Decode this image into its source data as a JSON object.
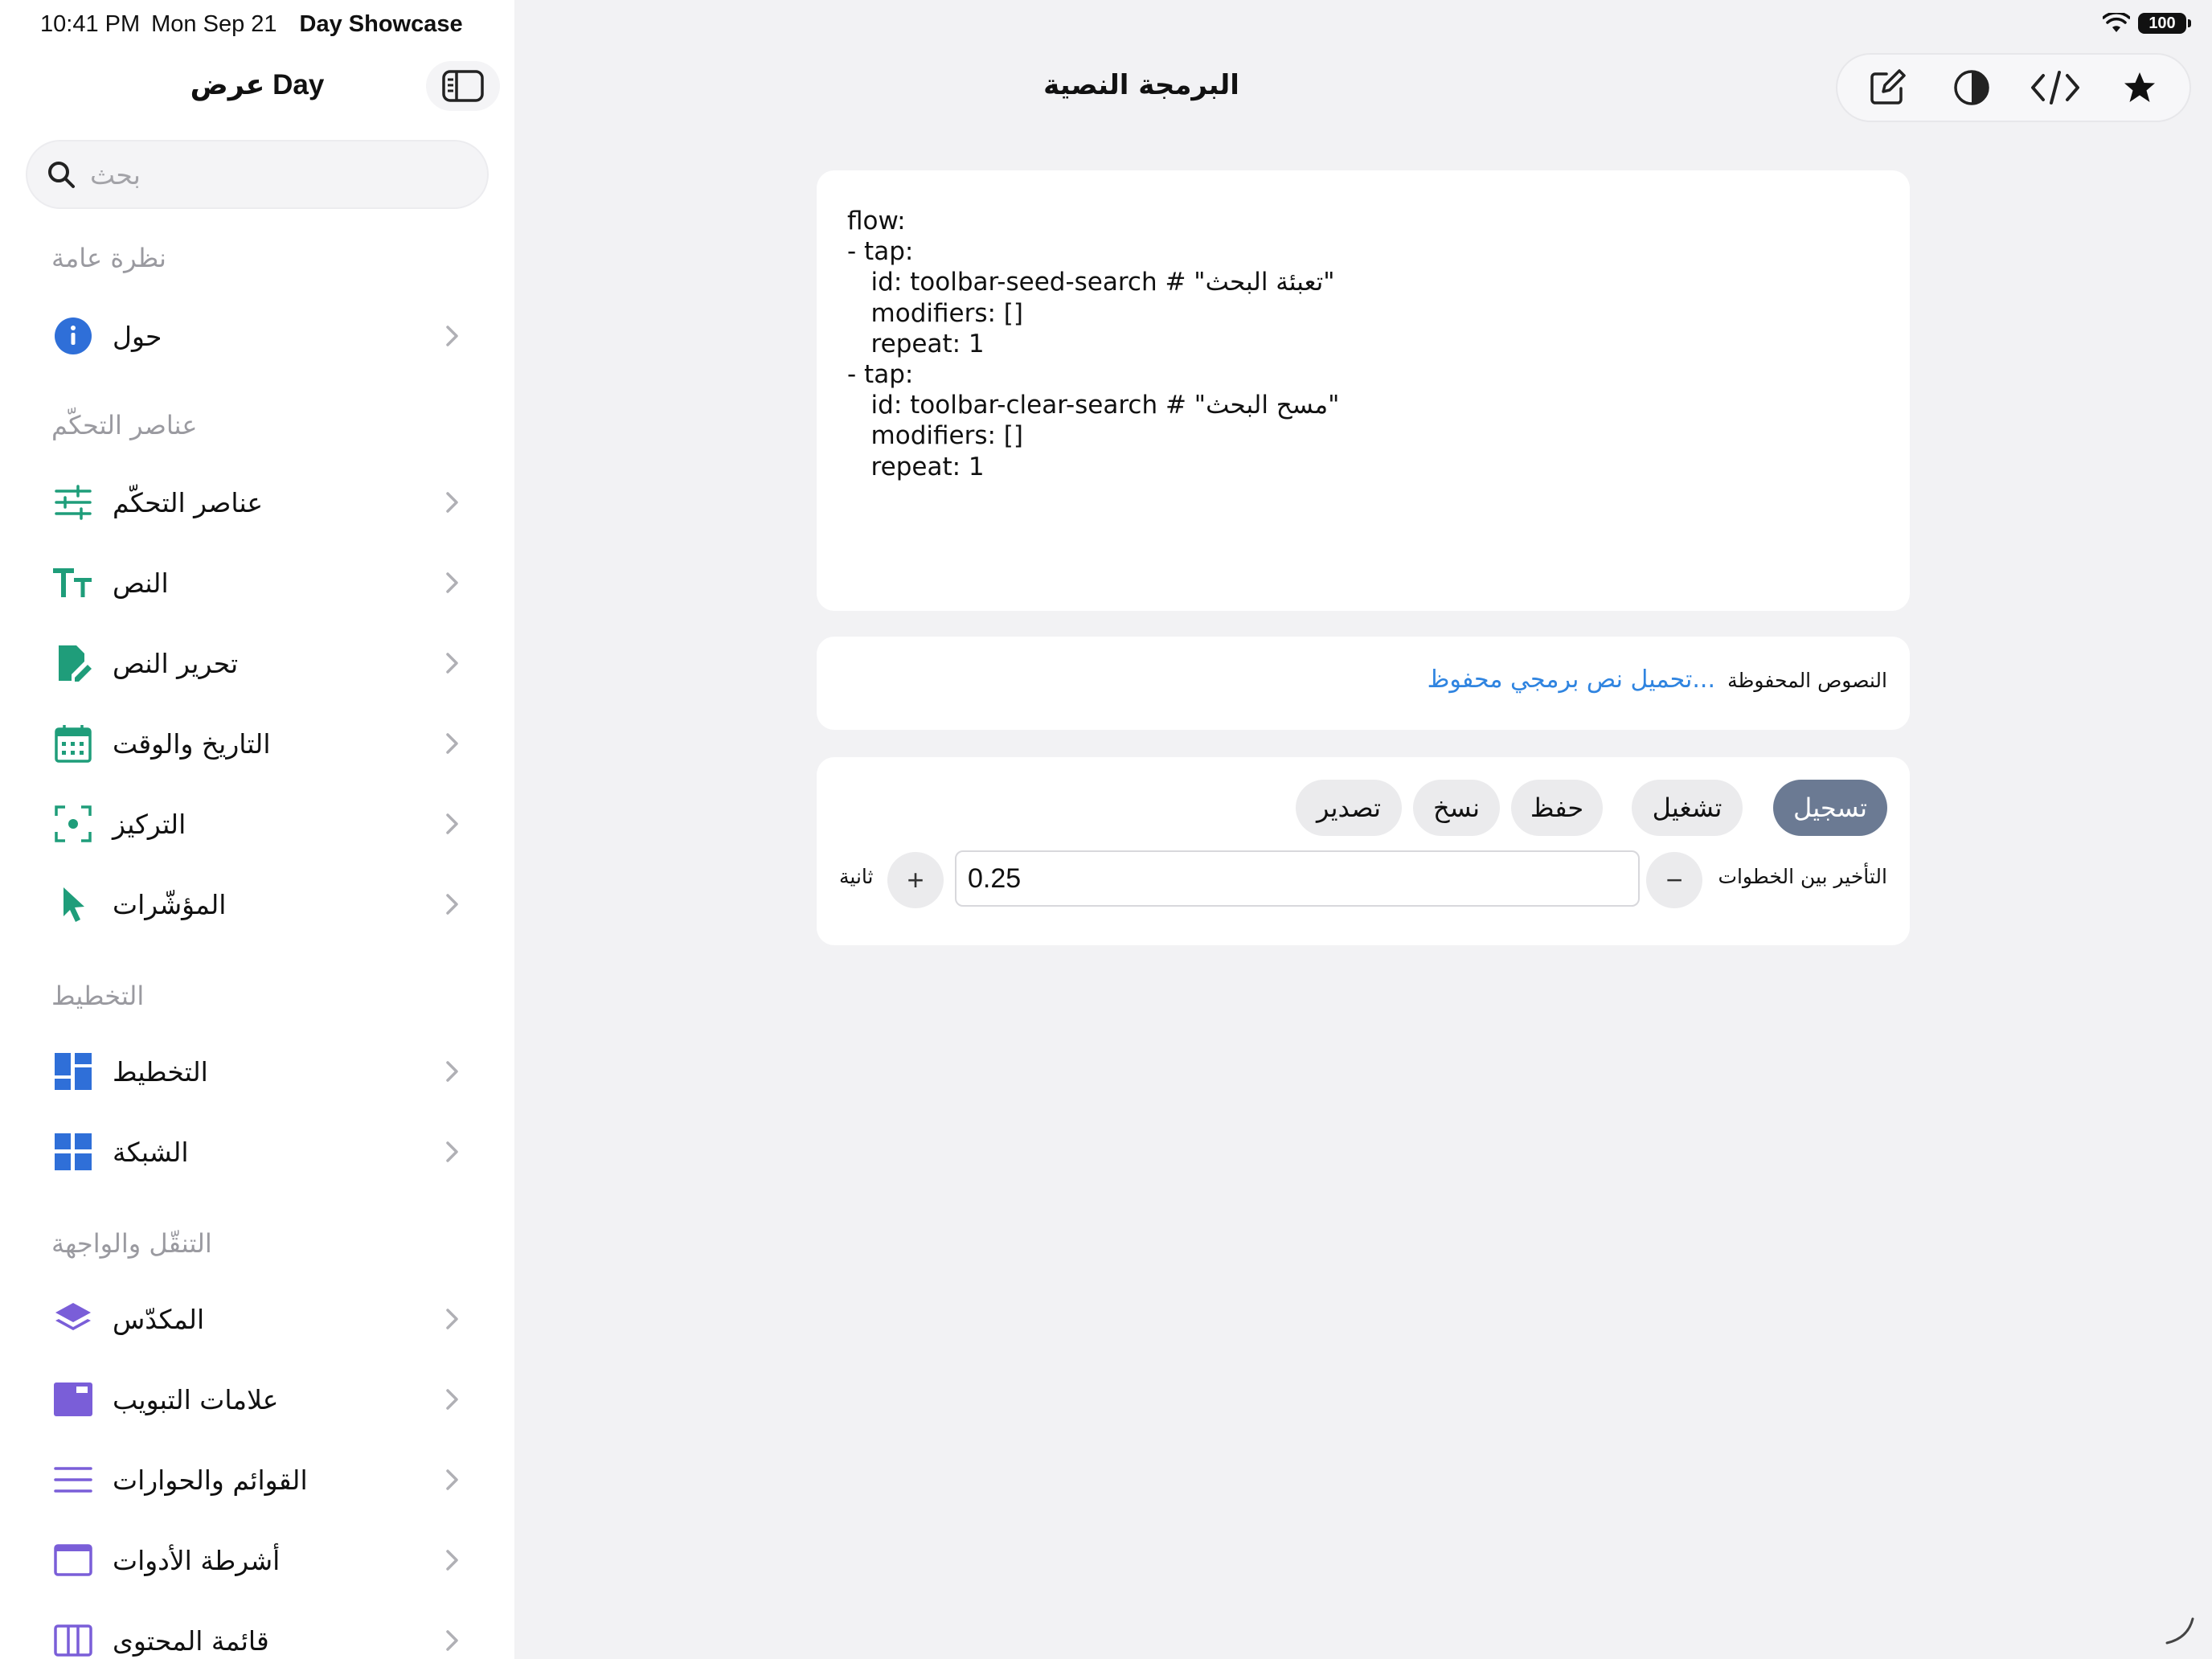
{
  "status_bar": {
    "time": "10:41 PM",
    "date": "Mon Sep 21",
    "app_name": "Day Showcase",
    "battery": "100"
  },
  "sidebar": {
    "title": "عرض Day",
    "search_placeholder": "بحث",
    "sections": [
      {
        "header": "نظرة عامة",
        "items": [
          {
            "label": "حول",
            "icon": "info-icon"
          }
        ]
      },
      {
        "header": "عناصر التحكّم",
        "items": [
          {
            "label": "عناصر التحكّم",
            "icon": "sliders-icon"
          },
          {
            "label": "النص",
            "icon": "text-size-icon"
          },
          {
            "label": "تحرير النص",
            "icon": "document-edit-icon"
          },
          {
            "label": "التاريخ والوقت",
            "icon": "calendar-icon"
          },
          {
            "label": "التركيز",
            "icon": "focus-icon"
          },
          {
            "label": "المؤشّرات",
            "icon": "pointer-icon"
          }
        ]
      },
      {
        "header": "التخطيط",
        "items": [
          {
            "label": "التخطيط",
            "icon": "layout-icon"
          },
          {
            "label": "الشبكة",
            "icon": "grid-icon"
          }
        ]
      },
      {
        "header": "التنقّل والواجهة",
        "items": [
          {
            "label": "المكدّس",
            "icon": "stack-icon"
          },
          {
            "label": "علامات التبويب",
            "icon": "tabs-icon"
          },
          {
            "label": "القوائم والحوارات",
            "icon": "list-icon"
          },
          {
            "label": "أشرطة الأدوات",
            "icon": "toolbar-icon"
          },
          {
            "label": "قائمة المحتوى",
            "icon": "sidebar-panel-icon"
          }
        ]
      }
    ]
  },
  "main": {
    "title": "البرمجة النصية",
    "toolbar": [
      "compose-icon",
      "contrast-icon",
      "code-icon",
      "star-icon"
    ],
    "script_text": "flow:\n- tap:\n   id: toolbar-seed-search # \"تعبئة البحث\"\n   modifiers: []\n   repeat: 1\n- tap:\n   id: toolbar-clear-search # \"مسح البحث\"\n   modifiers: []\n   repeat: 1",
    "saved_scripts_label": "النصوص المحفوظة",
    "load_saved_link": "تحميل نص برمجي محفوظ...",
    "actions": {
      "record": "تسجيل",
      "run": "تشغيل",
      "save": "حفظ",
      "copy": "نسخ",
      "export": "تصدير"
    },
    "delay_label": "التأخير بين الخطوات",
    "delay_value": "0.25",
    "delay_unit": "ثانية",
    "decrement": "−",
    "increment": "+"
  },
  "colors": {
    "accent": "#2f84e0",
    "teal": "#1f9d7a",
    "blue": "#2f6fd8",
    "purple": "#7a5ed8",
    "primary_button": "#6b7a93"
  }
}
